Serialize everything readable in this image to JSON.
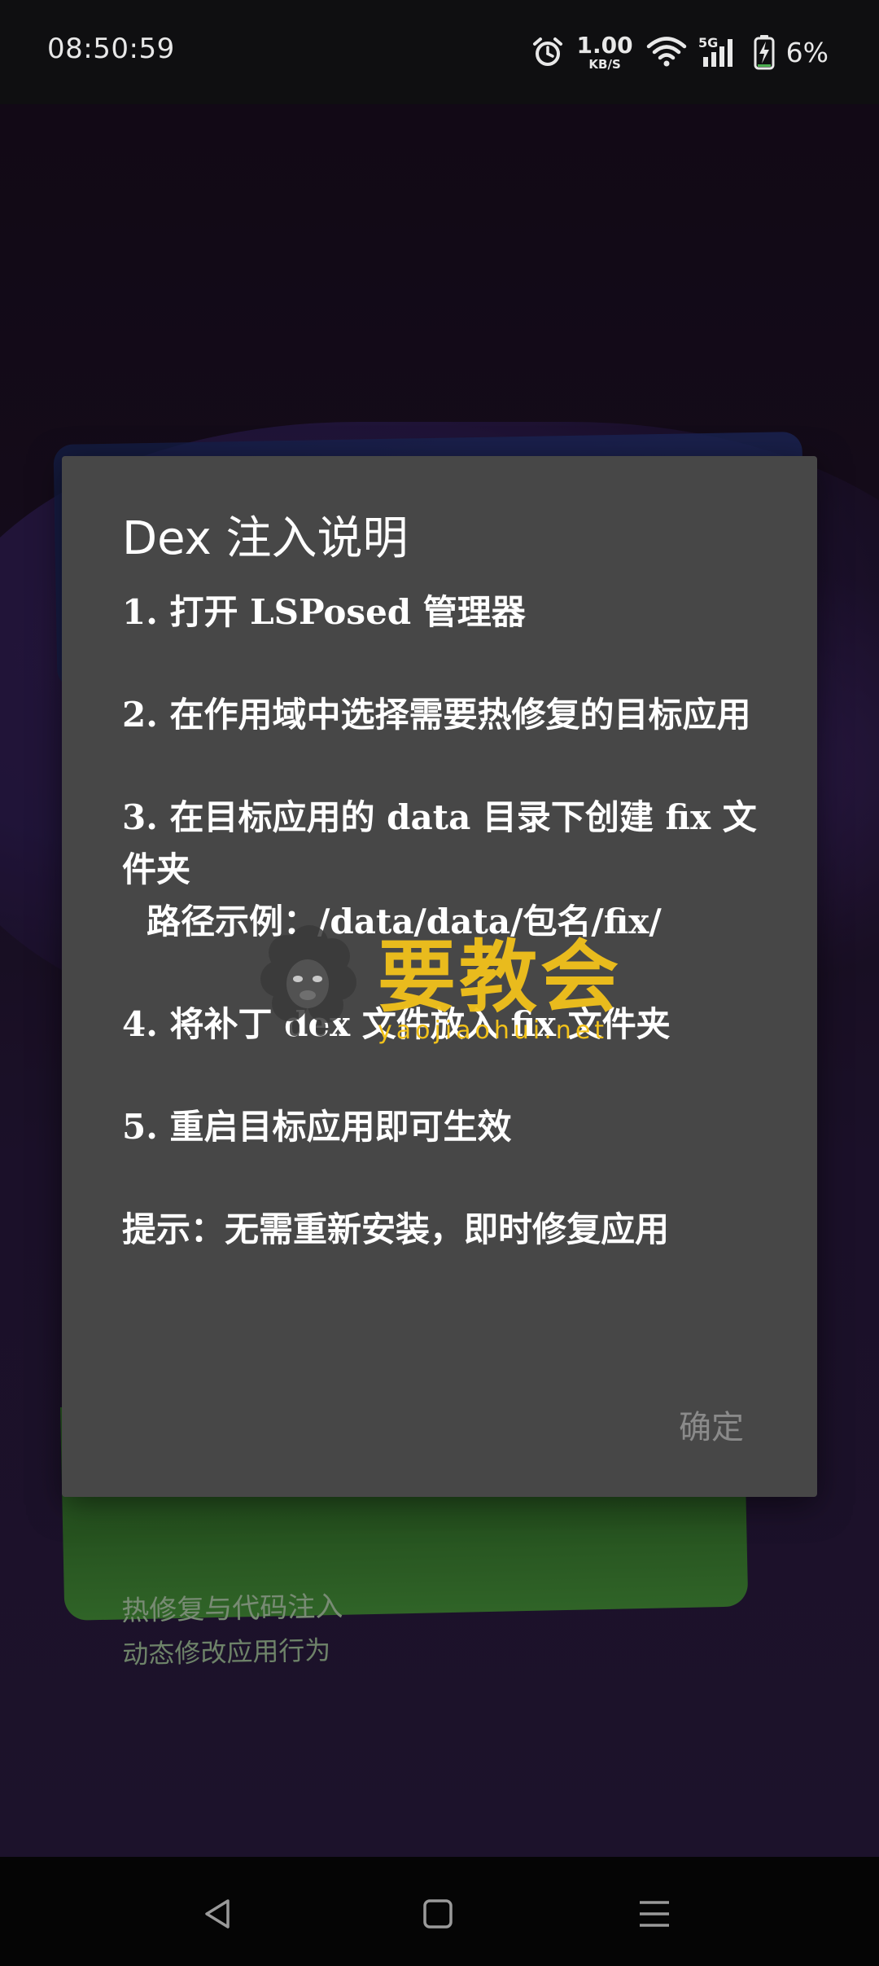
{
  "status_bar": {
    "time": "08:50:59",
    "net_speed_value": "1.00",
    "net_speed_unit": "KB/S",
    "network_type": "5G",
    "battery_percent": "6%",
    "icons": [
      "alarm-icon",
      "wifi-icon",
      "signal-5g-icon",
      "battery-charging-icon"
    ]
  },
  "background_app": {
    "card_title": "热修复与代码注入",
    "card_subtitle": "动态修改应用行为"
  },
  "dialog": {
    "title": "Dex 注入说明",
    "paragraphs": [
      "1. 打开 LSPosed 管理器",
      "2. 在作用域中选择需要热修复的目标应用",
      "3. 在目标应用的 data 目录下创建 fix 文件夹",
      "路径示例：/data/data/包名/fix/",
      "4. 将补丁 dex 文件放入 fix 文件夹",
      "5. 重启目标应用即可生效",
      "提示：无需重新安装，即时修复应用"
    ],
    "confirm_label": "确定"
  },
  "watermark": {
    "title": "要教会",
    "url": "yaojiaohui.net"
  },
  "nav_bar": {
    "buttons": [
      "back-icon",
      "home-icon",
      "menu-icon"
    ]
  },
  "colors": {
    "dialog_bg": "#474747",
    "dialog_text": "#ffffff",
    "confirm_text": "#8a8a8a",
    "watermark": "#f2c21b",
    "green_card": "#3f8b35"
  }
}
